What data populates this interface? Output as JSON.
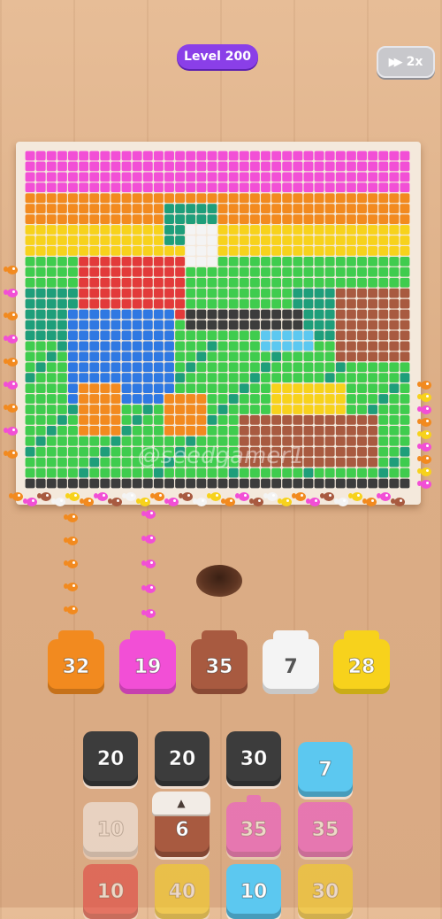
{
  "header": {
    "level_label": "Level 200",
    "speed_icon": "fast-forward-icon",
    "speed_label": "2x"
  },
  "watermark": "@seedgamer1",
  "colors": {
    "magenta": "#f24fd6",
    "orange": "#f28a1f",
    "yellow": "#f7d21c",
    "brown": "#a85a40",
    "white": "#f4f4f4",
    "dark": "#3c3c3c",
    "cyan": "#5cc8f0",
    "red": "#e23a3a",
    "green": "#3fcc4e",
    "teal": "#1e9e7a",
    "blue": "#2f78e2"
  },
  "cups": [
    {
      "count": "32",
      "color": "orange"
    },
    {
      "count": "19",
      "color": "magenta"
    },
    {
      "count": "35",
      "color": "brown"
    },
    {
      "count": "7",
      "color": "white"
    },
    {
      "count": "28",
      "color": "yellow"
    }
  ],
  "tiles": [
    {
      "count": "20",
      "color": "dark"
    },
    {
      "count": "20",
      "color": "dark"
    },
    {
      "count": "30",
      "color": "dark"
    },
    {
      "count": "7",
      "color": "cyan"
    },
    {
      "count": "10",
      "color": "white"
    },
    {
      "count": "6",
      "color": "brown"
    },
    {
      "count": "35",
      "color": "magenta"
    },
    {
      "count": "35",
      "color": "magenta"
    },
    {
      "count": "10",
      "color": "red"
    },
    {
      "count": "40",
      "color": "yellow"
    },
    {
      "count": "10",
      "color": "cyan"
    },
    {
      "count": "30",
      "color": "yellow"
    }
  ]
}
